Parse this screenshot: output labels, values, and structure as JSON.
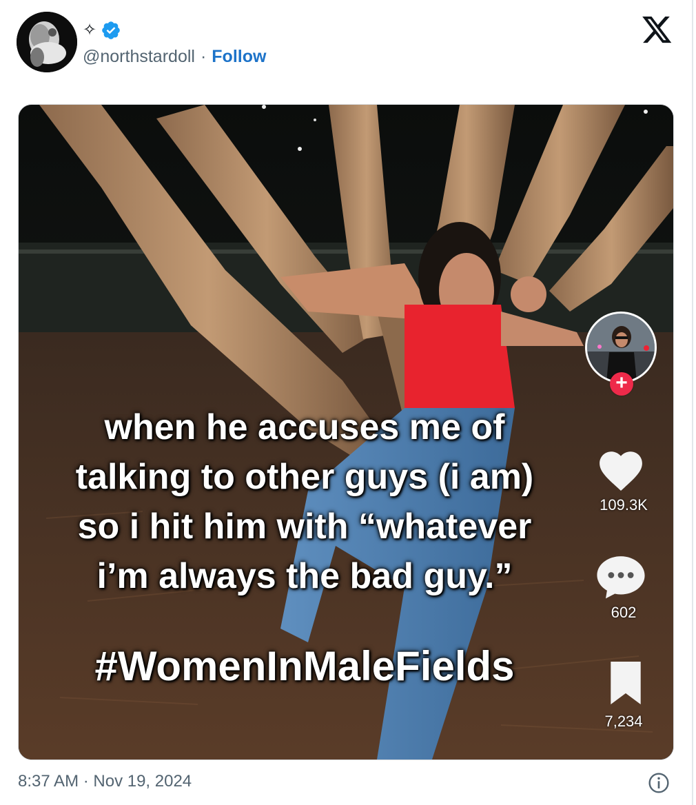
{
  "author": {
    "display_name": "✧",
    "handle": "@northstardoll",
    "separator": "·",
    "follow_label": "Follow",
    "verified": true
  },
  "media": {
    "caption_lines": [
      "when he accuses me of",
      "talking to other guys (i am)",
      "so i hit him with “whatever",
      "i’m always the bad guy.”"
    ],
    "hashtag": "#WomenInMaleFields",
    "likes": "109.3K",
    "comments": "602",
    "saves": "7,234"
  },
  "footer": {
    "timestamp": "8:37 AM · Nov 19, 2024"
  },
  "colors": {
    "follow": "#1d73c9",
    "muted": "#536471",
    "verified": "#1d9bf0",
    "plus": "#ee2a4a"
  }
}
